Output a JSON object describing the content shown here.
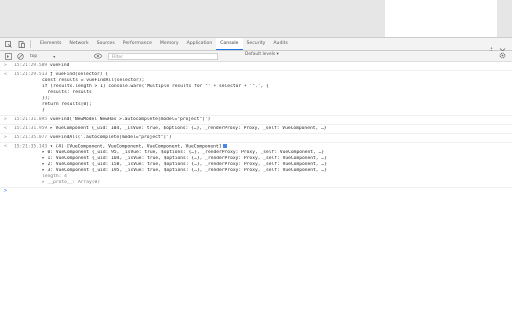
{
  "devtools": {
    "tabs": [
      {
        "label": "Elements",
        "active": false
      },
      {
        "label": "Network",
        "active": false
      },
      {
        "label": "Sources",
        "active": false
      },
      {
        "label": "Performance",
        "active": false
      },
      {
        "label": "Memory",
        "active": false
      },
      {
        "label": "Application",
        "active": false
      },
      {
        "label": "Console",
        "active": true
      },
      {
        "label": "Security",
        "active": false
      },
      {
        "label": "Audits",
        "active": false
      }
    ]
  },
  "toolbar": {
    "context": "top",
    "filter_placeholder": "Filter",
    "levels": "Default levels ▾"
  },
  "console": {
    "entries": [
      {
        "ts": "15:21:29.509",
        "code": "vueFind"
      },
      {
        "ts": "15:21:29.513",
        "code": "ƒ vueFind(selector) {"
      },
      {
        "indent": "const results = vueFindAll(selector);"
      },
      {
        "indent": "if (results.length > 1) console.warn('Multiple results for \"' + selector + '\".', {"
      },
      {
        "indent": "  results: results"
      },
      {
        "indent": "});"
      },
      {
        "indent": "return results[0];"
      },
      {
        "indent": "}"
      },
      {
        "ts": "15:21:31.895",
        "code": "vueFind('NewModel NewHas >.autocomplete[model=\"project\"]')"
      },
      {
        "ts": "15:21:31.959",
        "code": "▸ VueComponent {_uid: 104, _isVue: true, $options: {…}, _renderProxy: Proxy, _self: VueComponent, …}"
      },
      {
        "ts": "15:21:35.077",
        "code": "vueFindAll('.autocomplete[model=\"project\"]')"
      },
      {
        "ts": "15:21:35.143",
        "code": "▾ (4) [VueComponent, VueComponent, VueComponent, VueComponent]"
      }
    ],
    "array_items": [
      "▸ 0: VueComponent {_uid: 95, _isVue: true, $options: {…}, _renderProxy: Proxy, _self: VueComponent, …}",
      "▸ 1: VueComponent {_uid: 104, _isVue: true, $options: {…}, _renderProxy: Proxy, _self: VueComponent, …}",
      "▸ 2: VueComponent {_uid: 158, _isVue: true, $options: {…}, _renderProxy: Proxy, _self: VueComponent, …}",
      "▸ 3: VueComponent {_uid: 195, _isVue: true, $options: {…}, _renderProxy: Proxy, _self: VueComponent, …}"
    ],
    "length_line": "length: 4",
    "proto_line": "▸ __proto__: Array(0)",
    "prompt": ">"
  }
}
